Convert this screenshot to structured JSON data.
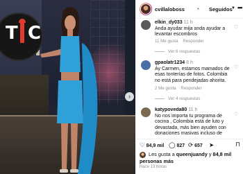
{
  "post": {
    "username": "cvillaloboss",
    "dot": "•",
    "follow_label": "Seguidos",
    "more_icon": "more-dots-icon",
    "logo_left": "T",
    "logo_right": "C"
  },
  "comments": [
    {
      "username": "elkin_dy033",
      "time": "11 h",
      "text": "Anda ayudar mija anda ayudar a levantar escombros",
      "likes": "11 Me gusta",
      "reply": "Responder",
      "replies": "Ver 6 respuestas",
      "avatar_color": "#5a5a5a"
    },
    {
      "username": "gpaolatr1234",
      "time": "8 h",
      "text": "Ay Carmen, estamos mamados de esas tonterías de fotos. Colombia no está para pendejadas ahorita.",
      "likes": "2 Me gusta",
      "reply": "Responder",
      "replies": "Ver 4 respuestas",
      "avatar_color": "#4a6fa5"
    },
    {
      "username": "katypoveda80",
      "time": "11 h",
      "text": "No nos importa tu programa de cocina , Colombia está de luto y devastada, más bien ayuden con donaciones masivas incluso de",
      "avatar_color": "#7a6a50"
    }
  ],
  "actions": {
    "likes_count": "84,9 mil",
    "comments_count": "827",
    "shares_count": "657"
  },
  "liked_by": {
    "prefix": "Les gusta a",
    "user": "queenjuandy",
    "middle": "y",
    "count": "84,8 mil personas más"
  },
  "posted_ago": "Hace 13 horas",
  "colors": {
    "dress": "#2fa0d8",
    "logo_red": "#e23b2e"
  }
}
